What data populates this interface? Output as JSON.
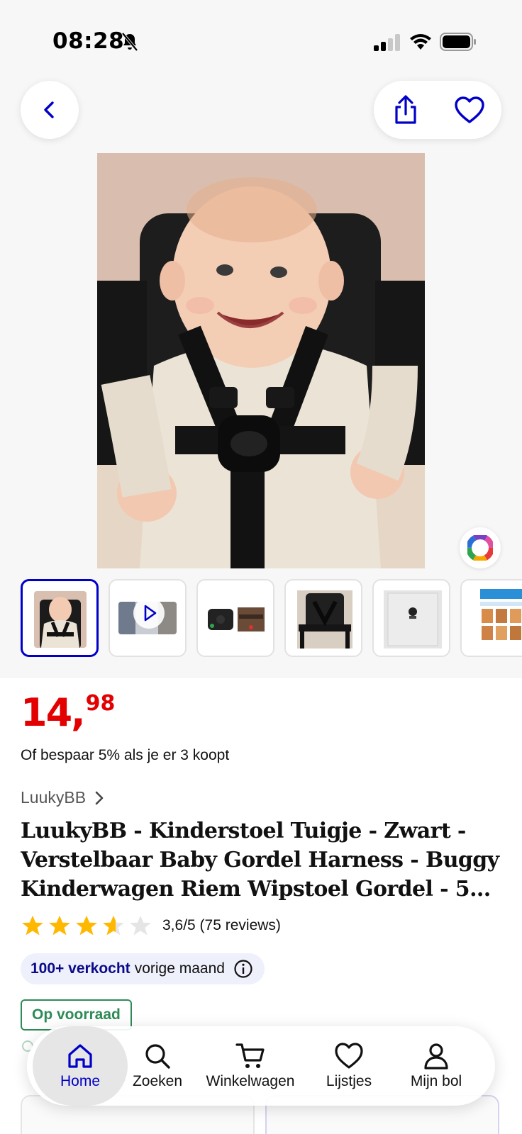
{
  "status_bar": {
    "time": "08:28",
    "icons": [
      "bell-slash-icon",
      "signal-icon",
      "wifi-icon",
      "battery-icon"
    ]
  },
  "nav": {
    "back_icon": "chevron-left-icon",
    "share_icon": "share-icon",
    "favorite_icon": "heart-icon"
  },
  "gallery": {
    "main_image": "baby-in-high-chair-with-harness",
    "color_picker_icon": "color-wheel-icon",
    "thumbnails": [
      {
        "name": "baby-harness-photo",
        "selected": true
      },
      {
        "name": "video-thumbnail",
        "selected": false
      },
      {
        "name": "harness-closeup",
        "selected": false
      },
      {
        "name": "high-chair",
        "selected": false
      },
      {
        "name": "packaging",
        "selected": false
      },
      {
        "name": "manual",
        "selected": false
      }
    ]
  },
  "product": {
    "price_int": "14",
    "price_sep": ",",
    "price_dec": "98",
    "bulk_offer": "Of bespaar 5% als je er 3 koopt",
    "seller": "LuukyBB",
    "title": "LuukyBB - Kinderstoel Tuigje - Zwart - Verstelbaar Baby Gordel Harness - Buggy Kinderwagen Riem Wipstoel Gordel - 5...",
    "rating_value": 3.6,
    "rating_text": "3,6/5 (75 reviews)",
    "sold_strong": "100+ verkocht",
    "sold_rest": "vorige maand",
    "stock": "Op voorraad"
  },
  "bottom_nav": [
    {
      "label": "Home",
      "icon": "home-icon",
      "active": true
    },
    {
      "label": "Zoeken",
      "icon": "search-icon",
      "active": false
    },
    {
      "label": "Winkelwagen",
      "icon": "cart-icon",
      "active": false
    },
    {
      "label": "Lijstjes",
      "icon": "heart-icon",
      "active": false
    },
    {
      "label": "Mijn bol",
      "icon": "user-icon",
      "active": false
    }
  ],
  "colors": {
    "brand_blue": "#0000c8",
    "price_red": "#e30000",
    "stock_green": "#2e8b57",
    "star_yellow": "#ffb800"
  }
}
